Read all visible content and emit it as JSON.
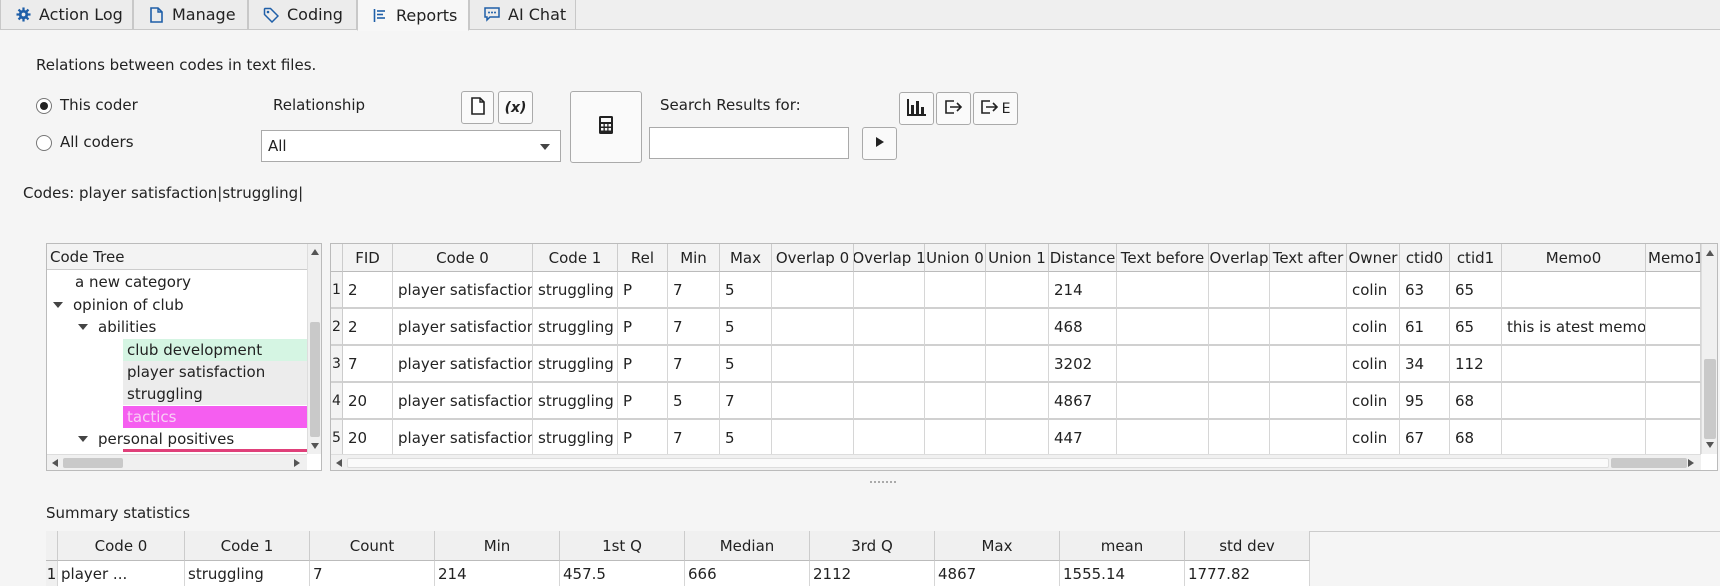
{
  "tabs": [
    {
      "label": "Action Log",
      "icon": "gear-icon"
    },
    {
      "label": "Manage",
      "icon": "document-icon"
    },
    {
      "label": "Coding",
      "icon": "tag-icon"
    },
    {
      "label": "Reports",
      "icon": "report-list-icon",
      "active": true
    },
    {
      "label": "AI Chat",
      "icon": "chat-icon"
    }
  ],
  "description": "Relations between codes in text files.",
  "coder_options": {
    "this_coder": "This coder",
    "all_coders": "All coders",
    "selected": "This coder"
  },
  "relationship": {
    "label": "Relationship",
    "selected": "All"
  },
  "toolbar": {
    "file_icon": "file-icon",
    "variable_icon_text": "(x)",
    "calculator_icon": "calculator-icon",
    "chart_icon": "bar-chart-icon",
    "export_icon": "export-icon",
    "export_e_label": "E"
  },
  "search": {
    "label": "Search Results for:",
    "value": "",
    "run_icon": "play-icon"
  },
  "codes_line": "Codes: player satisfaction|struggling|",
  "code_tree": {
    "header": "Code Tree",
    "items": [
      {
        "label": "a new category",
        "expander": false
      },
      {
        "label": "opinion of club",
        "expander": true
      },
      {
        "label": "abilities",
        "expander": true
      },
      {
        "label": "club development",
        "highlight": "#d5f5e3"
      },
      {
        "label": "player satisfaction",
        "highlight": "#ececec"
      },
      {
        "label": "struggling",
        "highlight": "#ececec"
      },
      {
        "label": "tactics",
        "highlight": "#f55ef0",
        "text_color": "#f8d0f5"
      },
      {
        "label": "personal positives",
        "expander": true
      }
    ]
  },
  "relations_table": {
    "headers": [
      "FID",
      "Code 0",
      "Code 1",
      "Rel",
      "Min",
      "Max",
      "Overlap 0",
      "Overlap 1",
      "Union 0",
      "Union 1",
      "Distance",
      "Text before",
      "Overlap",
      "Text after",
      "Owner",
      "ctid0",
      "ctid1",
      "Memo0",
      "Memo1"
    ],
    "rows": [
      {
        "n": "1",
        "cells": [
          "2",
          "player satisfaction",
          "struggling",
          "P",
          "7",
          "5",
          "",
          "",
          "",
          "",
          "214",
          "",
          "",
          "",
          "colin",
          "63",
          "65",
          "",
          ""
        ]
      },
      {
        "n": "2",
        "cells": [
          "2",
          "player satisfaction",
          "struggling",
          "P",
          "7",
          "5",
          "",
          "",
          "",
          "",
          "468",
          "",
          "",
          "",
          "colin",
          "61",
          "65",
          "this is atest memo",
          ""
        ]
      },
      {
        "n": "3",
        "cells": [
          "7",
          "player satisfaction",
          "struggling",
          "P",
          "7",
          "5",
          "",
          "",
          "",
          "",
          "3202",
          "",
          "",
          "",
          "colin",
          "34",
          "112",
          "",
          ""
        ]
      },
      {
        "n": "4",
        "cells": [
          "20",
          "player satisfaction",
          "struggling",
          "P",
          "5",
          "7",
          "",
          "",
          "",
          "",
          "4867",
          "",
          "",
          "",
          "colin",
          "95",
          "68",
          "",
          ""
        ]
      },
      {
        "n": "5",
        "cells": [
          "20",
          "player satisfaction",
          "struggling",
          "P",
          "7",
          "5",
          "",
          "",
          "",
          "",
          "447",
          "",
          "",
          "",
          "colin",
          "67",
          "68",
          "",
          ""
        ]
      }
    ]
  },
  "summary": {
    "title": "Summary statistics",
    "headers": [
      "Code 0",
      "Code 1",
      "Count",
      "Min",
      "1st Q",
      "Median",
      "3rd Q",
      "Max",
      "mean",
      "std dev"
    ],
    "rows": [
      {
        "n": "1",
        "cells": [
          "player ...",
          "struggling",
          "7",
          "214",
          "457.5",
          "666",
          "2112",
          "4867",
          "1555.14",
          "1777.82"
        ]
      }
    ]
  }
}
